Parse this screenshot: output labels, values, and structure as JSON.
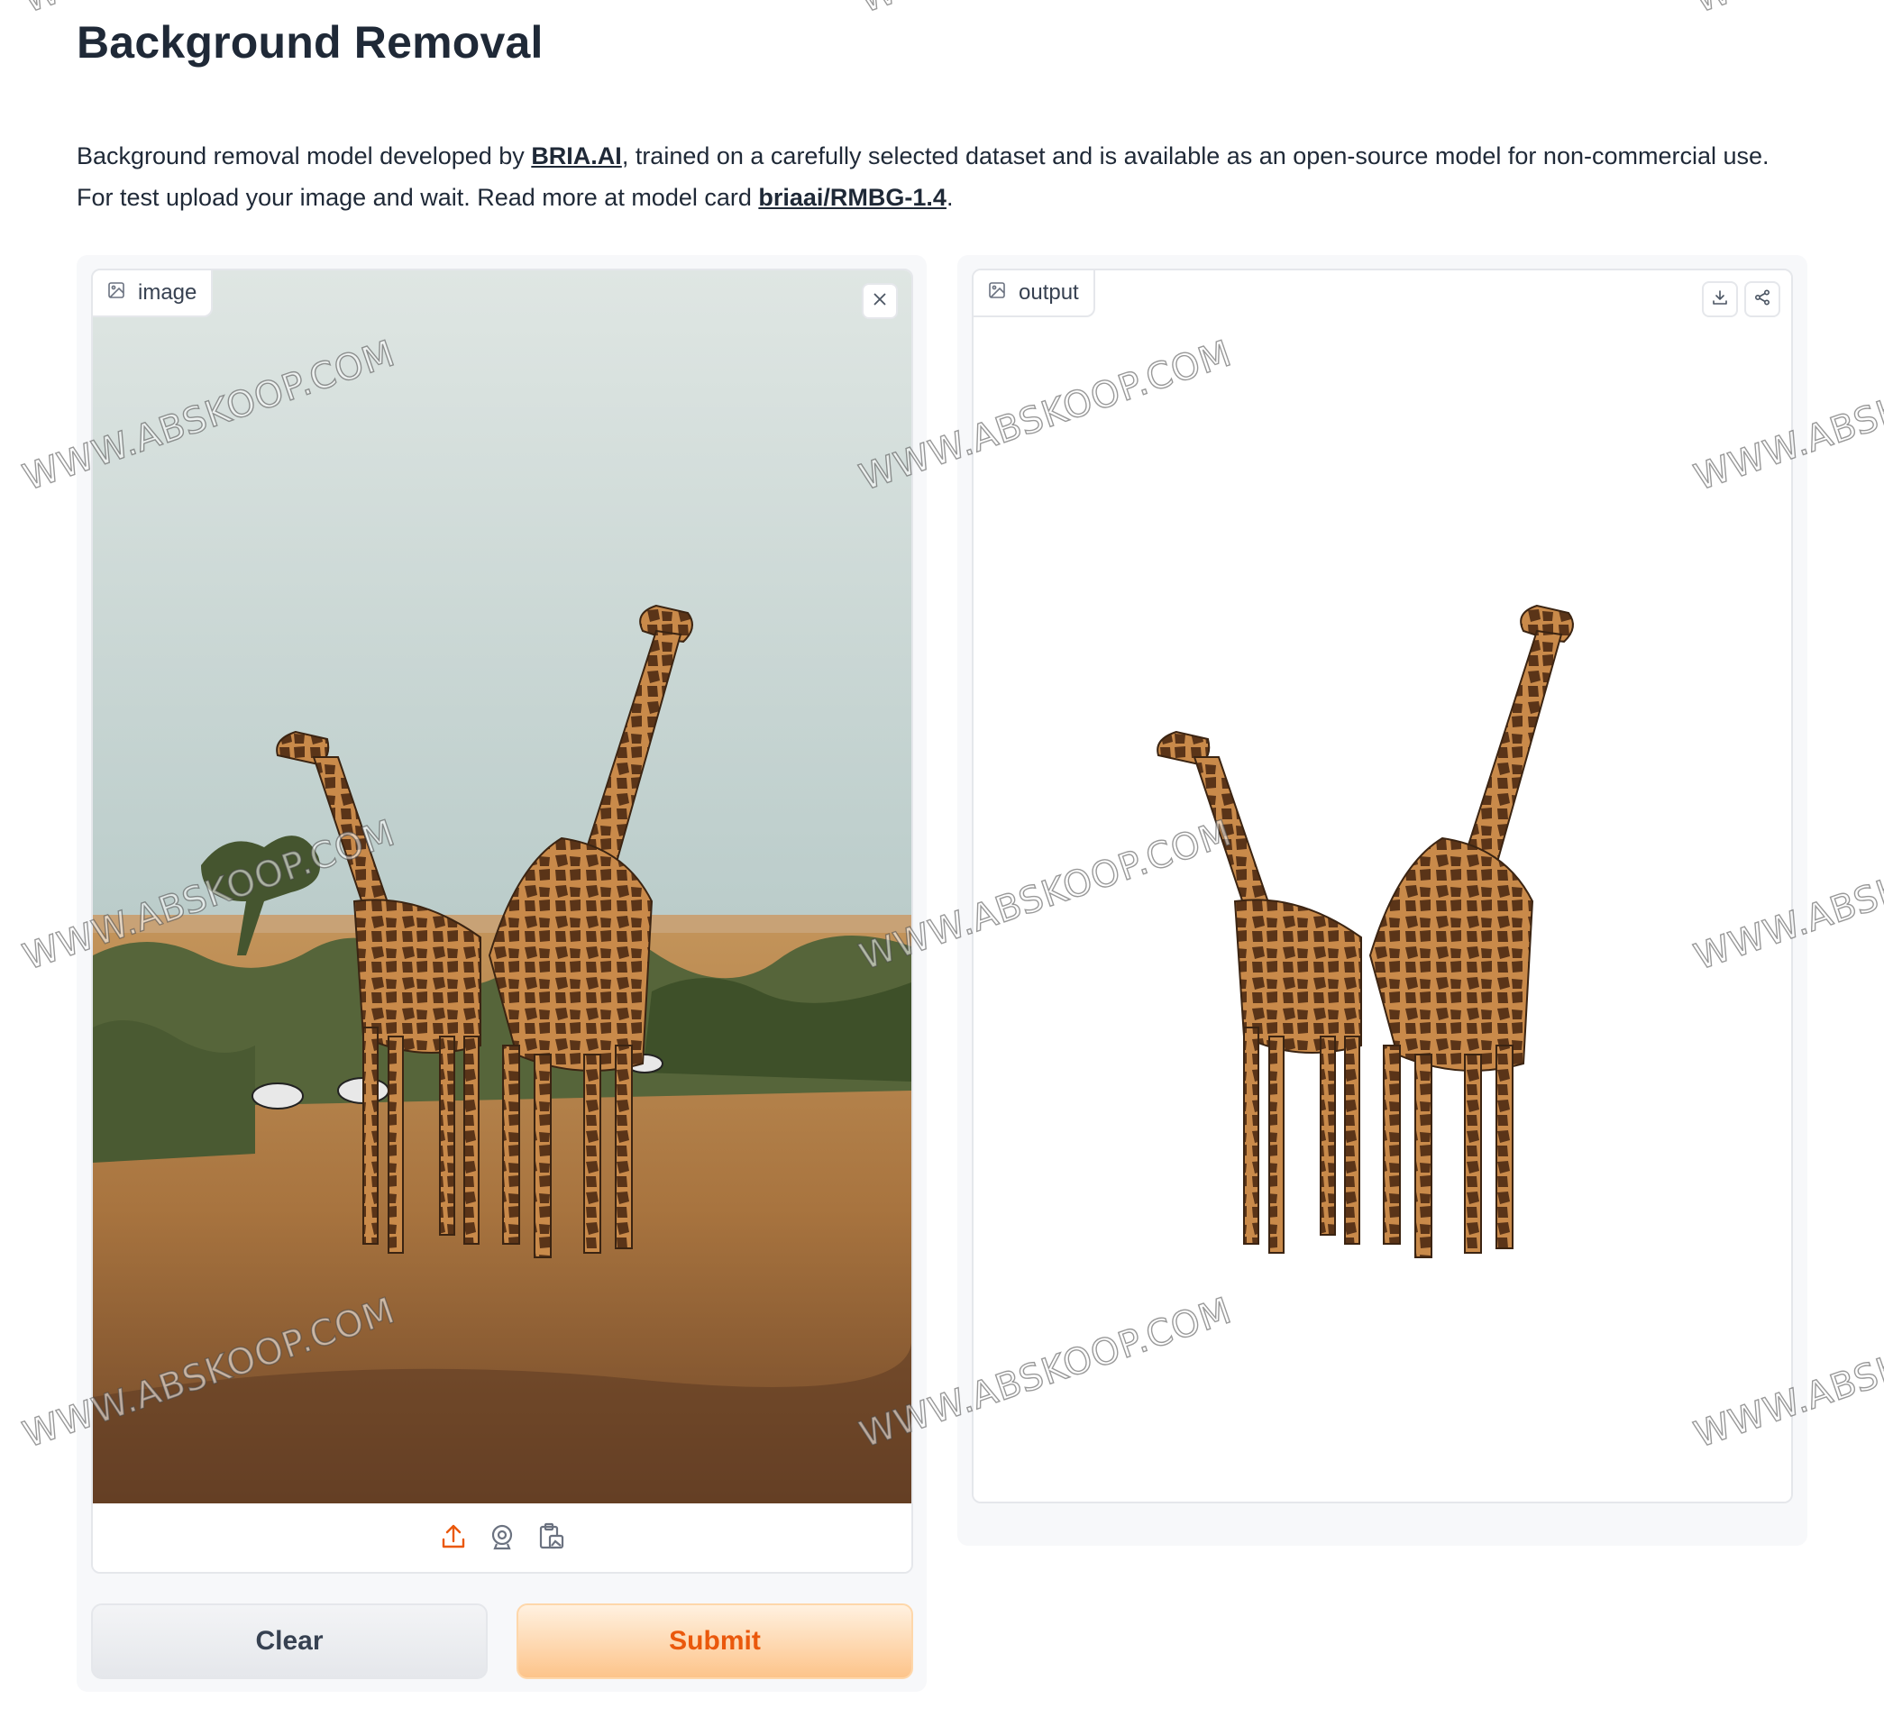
{
  "page": {
    "title": "Background Removal",
    "desc_line1_prefix": "Background removal model developed by ",
    "desc_link1": "BRIA.AI",
    "desc_line1_suffix": ", trained on a carefully selected dataset and is available as an open-source model for non-commercial use.",
    "desc_line2_prefix": "For test upload your image and wait. Read more at model card ",
    "desc_link2": "briaai/RMBG-1.4",
    "desc_line2_suffix": "."
  },
  "input_panel": {
    "label": "image",
    "label_icon": "image-icon",
    "clear_icon": "close-icon",
    "toolbar": [
      "upload-icon",
      "webcam-icon",
      "clipboard-icon"
    ]
  },
  "output_panel": {
    "label": "output",
    "label_icon": "image-icon",
    "actions": [
      "download-icon",
      "share-icon"
    ]
  },
  "buttons": {
    "clear": "Clear",
    "submit": "Submit"
  },
  "watermark": "WWW.ABSKOOP.COM",
  "colors": {
    "accent": "#ea580c",
    "submit_bg": "#fdc48a",
    "panel_bg": "#f7f8fa"
  }
}
